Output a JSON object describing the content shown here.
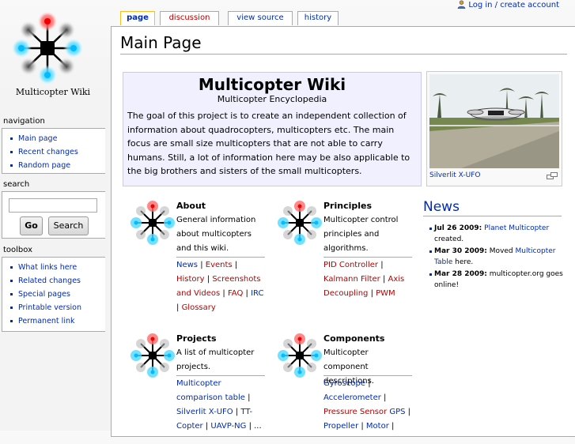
{
  "user_bar": {
    "login": "Log in / create account"
  },
  "logo": {
    "title": "Multicopter Wiki"
  },
  "tabs": {
    "page": "page",
    "discussion": "discussion",
    "view_source": "view source",
    "history": "history"
  },
  "heading": "Main Page",
  "intro": {
    "title": "Multicopter Wiki",
    "subtitle": "Multicopter Encyclopedia",
    "text": "The goal of this project is to create an independent collection of information about quadrocopters, multicopters etc. The main focus are small size multicopters that are not able to carry humans. Still, a lot of information here may be also applicable to the big brothers and sisters of the small multicopters."
  },
  "thumb": {
    "caption": "Silverlit X-UFO"
  },
  "about": {
    "title": "About",
    "desc": "General information about multicopters and this wiki.",
    "links": [
      "News",
      "Events",
      "History",
      "Screenshots and Videos",
      "FAQ",
      "IRC",
      "Glossary"
    ]
  },
  "principles": {
    "title": "Principles",
    "desc": "Multicopter control principles and algorithms.",
    "links": [
      "PID Controller",
      "Kalmann Filter",
      "Axis Decoupling",
      "PWM"
    ]
  },
  "projects": {
    "title": "Projects",
    "desc": "A list of multicopter projects.",
    "links": [
      "Multicopter comparison table",
      "Silverlit X-UFO",
      "TT-Copter",
      "UAVP-NG",
      "..."
    ]
  },
  "components": {
    "title": "Components",
    "desc": "Multicopter component descriptions.",
    "links": [
      "Gyroscope",
      "Accelerometer",
      "Pressure Sensor",
      "GPS",
      "Propeller",
      "Motor"
    ]
  },
  "news": {
    "title": "News",
    "items": [
      {
        "date": "Jul 26 2009:",
        "pre": "",
        "link": "Planet Multicopter",
        "post": "created."
      },
      {
        "date": "Mar 30 2009:",
        "pre": "Moved",
        "link": "Multicopter Table",
        "post": "here."
      },
      {
        "date": "Mar 28 2009:",
        "pre": "multicopter.org goes online!",
        "link": "",
        "post": ""
      }
    ]
  },
  "navigation": {
    "title": "navigation",
    "items": [
      "Main page",
      "Recent changes",
      "Random page"
    ]
  },
  "search": {
    "title": "search",
    "go": "Go",
    "search": "Search"
  },
  "toolbox": {
    "title": "toolbox",
    "items": [
      "What links here",
      "Related changes",
      "Special pages",
      "Printable version",
      "Permanent link"
    ]
  },
  "colors": {
    "link": "#002bb8",
    "new_link": "#ba0000",
    "intro_bg": "#f0f0ff",
    "tab_selected": "#fabd23"
  }
}
